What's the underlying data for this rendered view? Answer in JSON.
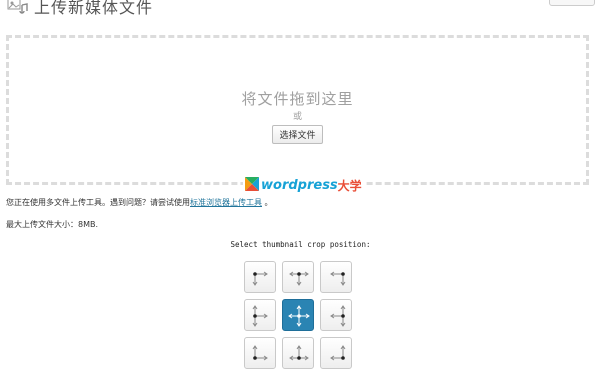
{
  "header": {
    "title": "上传新媒体文件",
    "icon": "media-upload-icon"
  },
  "dropzone": {
    "drop_text": "将文件拖到这里",
    "or_text": "或",
    "select_button": "选择文件"
  },
  "watermark": {
    "logo_text": "wordpress",
    "logo_cn": "大学",
    "icon": "wordpress-daxue-logo-icon"
  },
  "uploader_note": {
    "prefix": "您正在使用多文件上传工具。遇到问题？请尝试使用",
    "link": "标准浏览器上传工具",
    "suffix": " 。"
  },
  "max_size": "最大上传文件大小：8MB.",
  "crop": {
    "title": "Select thumbnail crop position:",
    "positions": [
      "left-top",
      "center-top",
      "right-top",
      "left-center",
      "center-center",
      "right-center",
      "left-bottom",
      "center-bottom",
      "right-bottom"
    ],
    "selected": "center-center"
  },
  "colors": {
    "accent": "#2a84b3",
    "link": "#21759b",
    "watermark_blue": "#17a2d6",
    "watermark_red": "#e94e37"
  }
}
